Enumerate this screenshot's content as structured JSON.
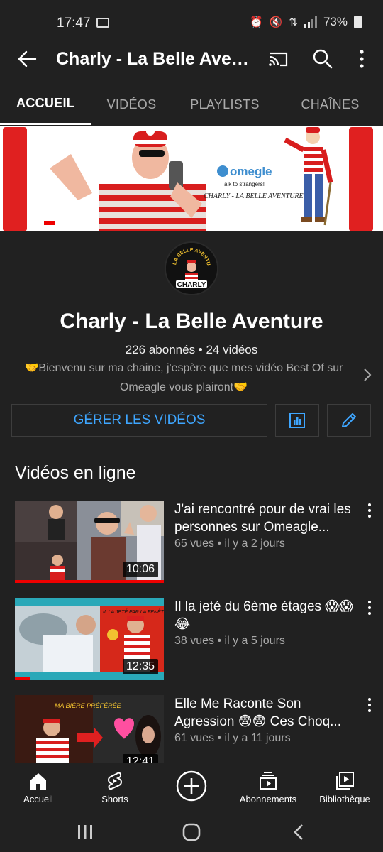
{
  "status_bar": {
    "time": "17:47",
    "battery": "73%"
  },
  "app_bar": {
    "title": "Charly - La Belle Aventure"
  },
  "tabs": [
    {
      "label": "ACCUEIL",
      "active": true
    },
    {
      "label": "VIDÉOS",
      "active": false
    },
    {
      "label": "PLAYLISTS",
      "active": false
    },
    {
      "label": "CHAÎNES",
      "active": false
    }
  ],
  "banner": {
    "omegle": "omegle",
    "omegle_tagline": "Talk to strangers!",
    "caption": "CHARLY - LA BELLE AVENTURE"
  },
  "avatar": {
    "top_text": "LA BELLE AVENTURE",
    "name": "CHARLY"
  },
  "channel": {
    "title": "Charly - La Belle Aventure",
    "stats": "226 abonnés • 24 vidéos",
    "description": "🤝Bienvenu sur ma chaine, j'espère que mes vidéo Best Of sur Omeagle vous plairont🤝"
  },
  "actions": {
    "manage_label": "GÉRER LES VIDÉOS"
  },
  "section": {
    "title": "Vidéos en ligne"
  },
  "videos": [
    {
      "title": "J'ai rencontré pour de vrai les personnes sur Omeagle...",
      "meta": "65 vues • il y a 2 jours",
      "duration": "10:06",
      "progress": 1.0
    },
    {
      "title": "Il la jeté du 6ème étages 😱😱😂",
      "meta": "38 vues • il y a 5 jours",
      "duration": "12:35",
      "progress": 0.1,
      "thumb_text": "IL LA JETÉ PAR LA FENÊTRE"
    },
    {
      "title": "Elle Me Raconte Son Agression 😨😨 Ces Choq...",
      "meta": "61 vues • il y a 11 jours",
      "duration": "12:41",
      "progress": 0,
      "thumb_text": "MA BIÈRE PRÉFÉRÉE"
    }
  ],
  "bottom_nav": [
    {
      "label": "Accueil",
      "icon": "home-icon"
    },
    {
      "label": "Shorts",
      "icon": "shorts-icon"
    },
    {
      "label": "",
      "icon": "create-icon"
    },
    {
      "label": "Abonnements",
      "icon": "subscriptions-icon"
    },
    {
      "label": "Bibliothèque",
      "icon": "library-icon"
    }
  ],
  "colors": {
    "background": "#212121",
    "accent_blue": "#3ea6ff",
    "red": "#e00000"
  }
}
